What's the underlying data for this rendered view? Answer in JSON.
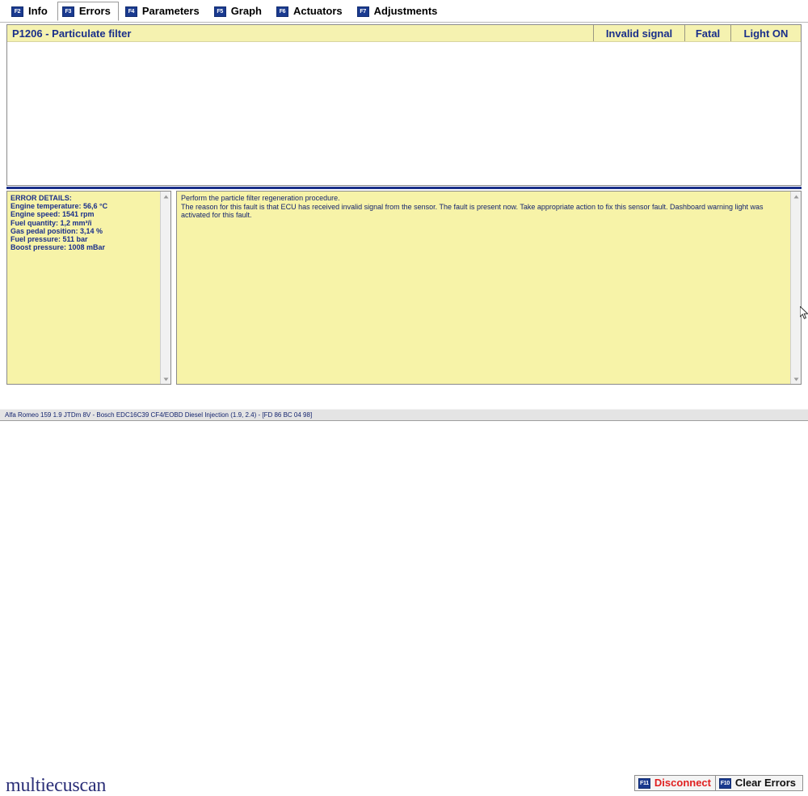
{
  "tabs": [
    {
      "key": "F2",
      "label": "Info",
      "active": false
    },
    {
      "key": "F3",
      "label": "Errors",
      "active": true
    },
    {
      "key": "F4",
      "label": "Parameters",
      "active": false
    },
    {
      "key": "F5",
      "label": "Graph",
      "active": false
    },
    {
      "key": "F6",
      "label": "Actuators",
      "active": false
    },
    {
      "key": "F7",
      "label": "Adjustments",
      "active": false
    }
  ],
  "error_list": {
    "rows": [
      {
        "code_description": "P1206 - Particulate filter",
        "status": "Invalid signal",
        "severity": "Fatal",
        "light": "Light ON"
      }
    ]
  },
  "details_pane": {
    "text": "ERROR DETAILS:\nEngine temperature: 56,6 °C\nEngine speed: 1541 rpm\nFuel quantity: 1,2 mm³/i\nGas pedal position: 3,14 %\nFuel pressure: 511 bar\nBoost pressure: 1008 mBar"
  },
  "description_pane": {
    "text": "Perform the particle filter regeneration procedure.\nThe reason for this fault is that ECU has received invalid signal from the sensor. The fault is present now. Take appropriate action to fix this sensor fault. Dashboard warning light was activated for this fault."
  },
  "branding": {
    "logo_text": "multiecuscan"
  },
  "buttons": {
    "disconnect": {
      "key": "F11",
      "label": "Disconnect"
    },
    "clear_errors": {
      "key": "F10",
      "label": "Clear Errors"
    }
  },
  "statusbar": {
    "text": "Alfa Romeo 159 1.9 JTDm 8V - Bosch EDC16C39 CF4/EOBD Diesel Injection (1.9, 2.4) - [FD 86 BC 04 98]"
  },
  "colors": {
    "accent_blue": "#1a3a8f",
    "row_yellow": "#f5f2b0",
    "pane_yellow": "#f7f3a8",
    "disconnect_red": "#e02020",
    "logo_navy": "#2b2f78"
  }
}
